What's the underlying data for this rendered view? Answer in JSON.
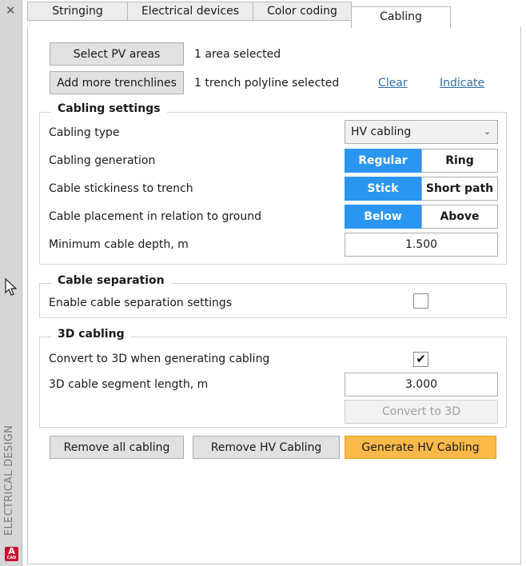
{
  "sidebar": {
    "title": "ELECTRICAL DESIGN",
    "close": "✕",
    "app_logo": "A",
    "app_logo_sub": "CAD"
  },
  "tabs": [
    {
      "label": "Stringing",
      "active": false
    },
    {
      "label": "Electrical devices",
      "active": false
    },
    {
      "label": "Color coding",
      "active": false
    },
    {
      "label": "Cabling",
      "active": true
    }
  ],
  "selection": {
    "select_pv_label": "Select PV areas",
    "pv_status": "1 area selected",
    "add_trench_label": "Add more trenchlines",
    "trench_status": "1 trench polyline selected",
    "clear_label": "Clear",
    "indicate_label": "Indicate"
  },
  "cabling_settings": {
    "title": "Cabling settings",
    "type_label": "Cabling type",
    "type_value": "HV cabling",
    "generation_label": "Cabling generation",
    "generation_options": [
      "Regular",
      "Ring"
    ],
    "generation_selected": "Regular",
    "stickiness_label": "Cable stickiness to trench",
    "stickiness_options": [
      "Stick",
      "Short path"
    ],
    "stickiness_selected": "Stick",
    "placement_label": "Cable placement in relation to ground",
    "placement_options": [
      "Below",
      "Above"
    ],
    "placement_selected": "Below",
    "depth_label": "Minimum cable depth, m",
    "depth_value": "1.500"
  },
  "cable_separation": {
    "title": "Cable separation",
    "enable_label": "Enable cable separation settings",
    "enabled": false
  },
  "cabling_3d": {
    "title": "3D cabling",
    "convert_label": "Convert to 3D when generating cabling",
    "convert_checked": true,
    "segment_label": "3D cable segment length, m",
    "segment_value": "3.000",
    "convert_button": "Convert to 3D"
  },
  "actions": {
    "remove_all": "Remove all cabling",
    "remove_hv": "Remove HV Cabling",
    "generate_hv": "Generate HV Cabling"
  },
  "colors": {
    "accent_blue": "#2b95f2",
    "action_orange": "#fbb949"
  }
}
